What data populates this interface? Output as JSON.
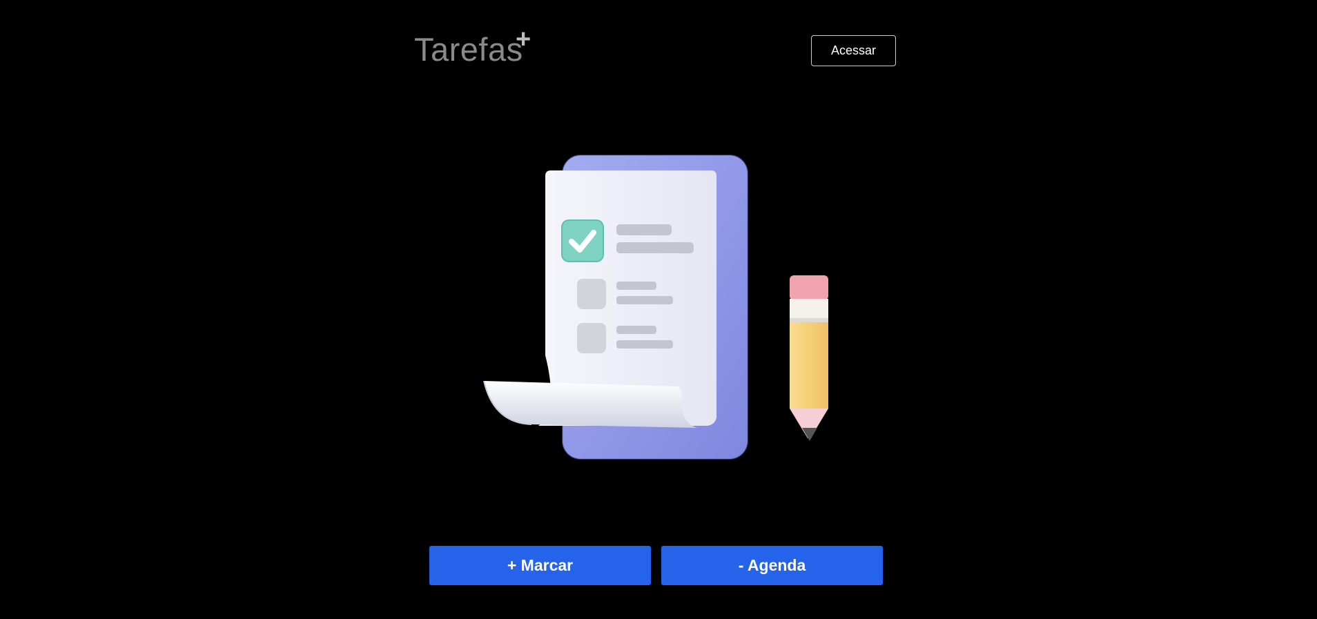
{
  "header": {
    "logo_text": "Tarefas",
    "logo_plus": "+",
    "login_label": "Acessar"
  },
  "hero": {
    "icon": "checklist-document-with-pencil-illustration",
    "colors": {
      "board": "#8e97e6",
      "paper": "#f1f2fa",
      "check": "#7fd3c2",
      "eraser": "#f0a3ad",
      "pencil": "#f7d27c"
    }
  },
  "actions": {
    "marcar_label": "+ Marcar",
    "agenda_label": "- Agenda",
    "accent": "#2563eb"
  }
}
